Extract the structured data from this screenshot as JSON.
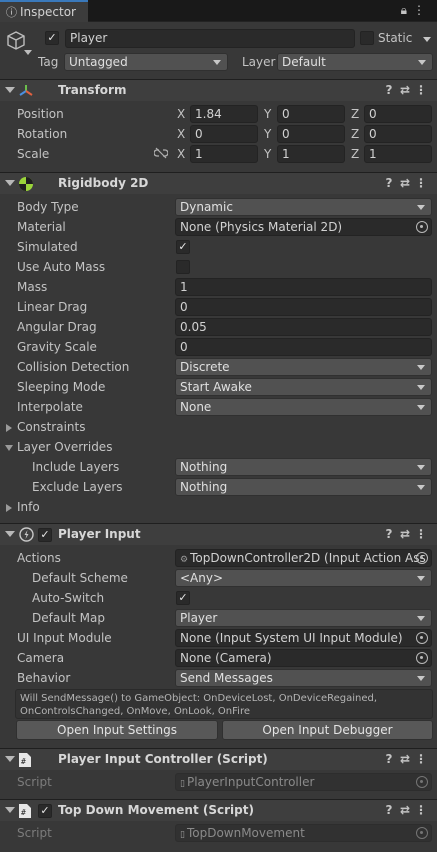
{
  "tab": {
    "title": "Inspector"
  },
  "go": {
    "name": "Player",
    "static_label": "Static",
    "tag_label": "Tag",
    "tag_value": "Untagged",
    "layer_label": "Layer",
    "layer_value": "Default"
  },
  "transform": {
    "title": "Transform",
    "position_label": "Position",
    "rotation_label": "Rotation",
    "scale_label": "Scale",
    "axes": [
      "X",
      "Y",
      "Z"
    ],
    "position": [
      "1.84",
      "0",
      "0"
    ],
    "rotation": [
      "0",
      "0",
      "0"
    ],
    "scale": [
      "1",
      "1",
      "1"
    ]
  },
  "rigidbody": {
    "title": "Rigidbody 2D",
    "rows": {
      "body_type": {
        "label": "Body Type",
        "value": "Dynamic"
      },
      "material": {
        "label": "Material",
        "value": "None (Physics Material 2D)"
      },
      "simulated": {
        "label": "Simulated",
        "checked": true
      },
      "auto_mass": {
        "label": "Use Auto Mass",
        "checked": false
      },
      "mass": {
        "label": "Mass",
        "value": "1"
      },
      "linear_drag": {
        "label": "Linear Drag",
        "value": "0"
      },
      "angular_drag": {
        "label": "Angular Drag",
        "value": "0.05"
      },
      "gravity": {
        "label": "Gravity Scale",
        "value": "0"
      },
      "collision": {
        "label": "Collision Detection",
        "value": "Discrete"
      },
      "sleeping": {
        "label": "Sleeping Mode",
        "value": "Start Awake"
      },
      "interpolate": {
        "label": "Interpolate",
        "value": "None"
      }
    },
    "constraints_label": "Constraints",
    "overrides_label": "Layer Overrides",
    "include_label": "Include Layers",
    "include_value": "Nothing",
    "exclude_label": "Exclude Layers",
    "exclude_value": "Nothing",
    "info_label": "Info"
  },
  "player_input": {
    "title": "Player Input",
    "actions_label": "Actions",
    "actions_value": "TopDownController2D (Input Action Ass",
    "scheme_label": "Default Scheme",
    "scheme_value": "<Any>",
    "autoswitch_label": "Auto-Switch",
    "autoswitch_checked": true,
    "map_label": "Default Map",
    "map_value": "Player",
    "ui_label": "UI Input Module",
    "ui_value": "None (Input System UI Input Module)",
    "camera_label": "Camera",
    "camera_value": "None (Camera)",
    "behavior_label": "Behavior",
    "behavior_value": "Send Messages",
    "help_line1": "Will SendMessage() to GameObject: OnDeviceLost, OnDeviceRegained,",
    "help_line2": "OnControlsChanged, OnMove, OnLook, OnFire",
    "btn_settings": "Open Input Settings",
    "btn_debugger": "Open Input Debugger"
  },
  "pic": {
    "title": "Player Input Controller (Script)",
    "script_label": "Script",
    "script_value": "PlayerInputController"
  },
  "tdm": {
    "title": "Top Down Movement (Script)",
    "script_label": "Script",
    "script_value": "TopDownMovement"
  },
  "colors": {
    "accent": "#3a79bb",
    "panel": "#383838",
    "header": "#3e3e3e",
    "field": "#2a2a2a"
  }
}
